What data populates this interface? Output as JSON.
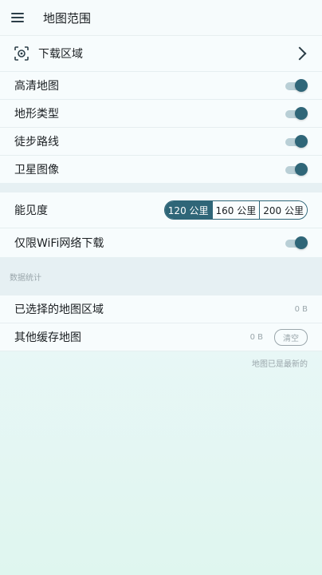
{
  "header": {
    "title": "地图范围"
  },
  "download": {
    "label": "下载区域"
  },
  "toggles": [
    {
      "label": "高清地图",
      "on": true
    },
    {
      "label": "地形类型",
      "on": true
    },
    {
      "label": "徒步路线",
      "on": true
    },
    {
      "label": "卫星图像",
      "on": true
    }
  ],
  "visibility": {
    "label": "能见度",
    "options": [
      "120 公里",
      "160 公里",
      "200 公里"
    ],
    "selected": "120 公里"
  },
  "wifi": {
    "label": "仅限WiFi网络下载",
    "on": true
  },
  "stats": {
    "header": "数据统计",
    "selected_area": {
      "label": "已选择的地图区域",
      "value": "0 B"
    },
    "other_cache": {
      "label": "其他缓存地图",
      "value": "0 B",
      "button": "清空"
    },
    "footer": "地图已是最新的"
  },
  "colors": {
    "accent": "#2f6678",
    "text": "#1b1f22",
    "muted": "#9aa6ab"
  }
}
